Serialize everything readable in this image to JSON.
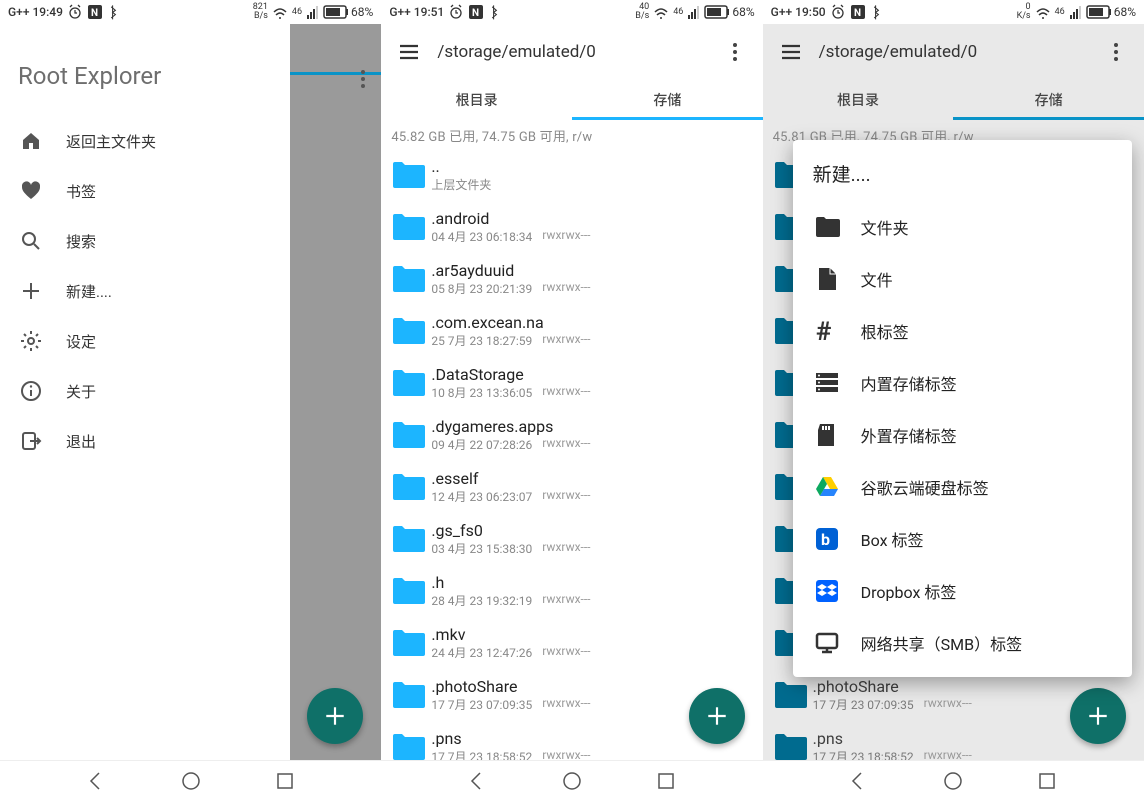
{
  "colors": {
    "accent": "#1cb5ff",
    "teal": "#0f7068",
    "folder_blue": "#1cb5ff",
    "folder_dark": "#006b8f"
  },
  "status": {
    "s1": {
      "time": "G++ 19:49",
      "speed_top": "821",
      "speed_bot": "B/s",
      "net": "46",
      "batt": "68%"
    },
    "s2": {
      "time": "G++ 19:51",
      "speed_top": "40",
      "speed_bot": "B/s",
      "net": "46",
      "batt": "68%"
    },
    "s3": {
      "time": "G++ 19:50",
      "speed_top": "0",
      "speed_bot": "K/s",
      "net": "46",
      "batt": "68%"
    }
  },
  "drawer": {
    "title": "Root Explorer",
    "items": [
      {
        "icon": "home-icon",
        "label": "返回主文件夹"
      },
      {
        "icon": "heart-icon",
        "label": "书签"
      },
      {
        "icon": "search-icon",
        "label": "搜索"
      },
      {
        "icon": "plus-icon",
        "label": "新建...."
      },
      {
        "icon": "gear-icon",
        "label": "设定"
      },
      {
        "icon": "info-icon",
        "label": "关于"
      },
      {
        "icon": "exit-icon",
        "label": "退出"
      }
    ]
  },
  "browser": {
    "path": "/storage/emulated/0",
    "tabs": {
      "root": "根目录",
      "storage": "存储"
    },
    "info2": "45.82 GB 已用, 74.75 GB 可用, r/w",
    "info3": "45.81 GB 已用, 74.75 GB 可用, r/w",
    "parent": {
      "name": "..",
      "sub": "上层文件夹"
    },
    "files": [
      {
        "name": ".android",
        "date": "04 4月 23 06:18:34",
        "perm": "rwxrwx---"
      },
      {
        "name": ".ar5ayduuid",
        "date": "05 8月 23 20:21:39",
        "perm": "rwxrwx---"
      },
      {
        "name": ".com.excean.na",
        "date": "25 7月 23 18:27:59",
        "perm": "rwxrwx---"
      },
      {
        "name": ".DataStorage",
        "date": "10 8月 23 13:36:05",
        "perm": "rwxrwx---"
      },
      {
        "name": ".dygameres.apps",
        "date": "09 4月 22 07:28:26",
        "perm": "rwxrwx---"
      },
      {
        "name": ".esself",
        "date": "12 4月 23 06:23:07",
        "perm": "rwxrwx---"
      },
      {
        "name": ".gs_fs0",
        "date": "03 4月 23 15:38:30",
        "perm": "rwxrwx---"
      },
      {
        "name": ".h",
        "date": "28 4月 23 19:32:19",
        "perm": "rwxrwx---"
      },
      {
        "name": ".mkv",
        "date": "24 4月 23 12:47:26",
        "perm": "rwxrwx---"
      },
      {
        "name": ".photoShare",
        "date": "17 7月 23 07:09:35",
        "perm": "rwxrwx---"
      },
      {
        "name": ".pns",
        "date": "17 7月 23 18:58:52",
        "perm": "rwxrwx---"
      }
    ]
  },
  "popup": {
    "title": "新建....",
    "items": [
      {
        "icon": "folder-icon",
        "label": "文件夹"
      },
      {
        "icon": "file-icon",
        "label": "文件"
      },
      {
        "icon": "hash-icon",
        "label": "根标签"
      },
      {
        "icon": "storage-icon",
        "label": "内置存储标签"
      },
      {
        "icon": "sd-icon",
        "label": "外置存储标签"
      },
      {
        "icon": "gdrive-icon",
        "label": "谷歌云端硬盘标签"
      },
      {
        "icon": "box-icon",
        "label": "Box 标签"
      },
      {
        "icon": "dropbox-icon",
        "label": "Dropbox 标签"
      },
      {
        "icon": "smb-icon",
        "label": "网络共享（SMB）标签"
      }
    ]
  }
}
